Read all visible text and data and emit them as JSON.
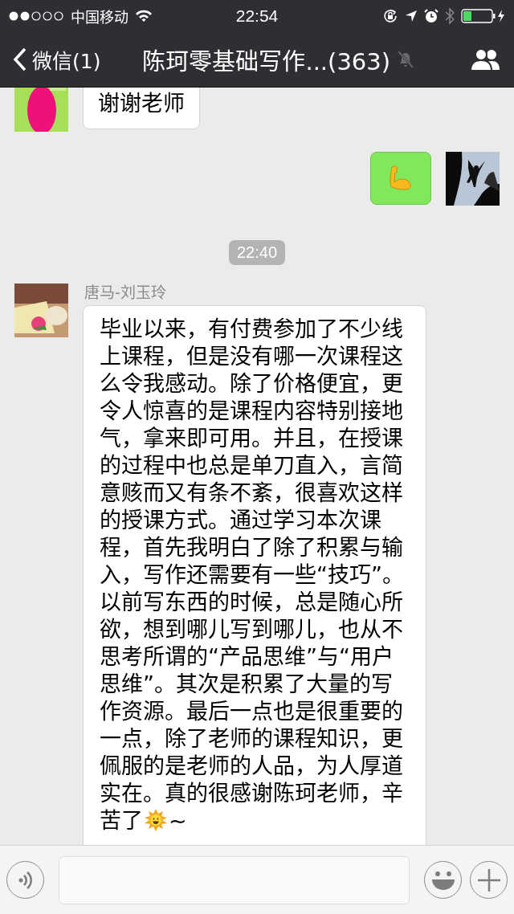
{
  "status_bar": {
    "carrier": "中国移动",
    "time": "22:54"
  },
  "nav": {
    "back_label": "微信(1)",
    "title": "陈珂零基础写作...(363)",
    "muted": true
  },
  "messages": [
    {
      "kind": "text",
      "outgoing": false,
      "text": "谢谢老师"
    },
    {
      "kind": "emoji",
      "outgoing": true
    },
    {
      "kind": "time",
      "text": "22:40"
    },
    {
      "kind": "text",
      "outgoing": false,
      "sender": "唐马-刘玉玲",
      "text": "毕业以来，有付费参加了不少线上课程，但是没有哪一次课程这么令我感动。除了价格便宜，更令人惊喜的是课程内容特别接地气，拿来即可用。并且，在授课的过程中也总是单刀直入，言简意赅而又有条不紊，很喜欢这样的授课方式。通过学习本次课程，首先我明白了除了积累与输入，写作还需要有一些“技巧”。以前写东西的时候，总是随心所欲，想到哪儿写到哪儿，也从不思考所谓的“产品思维”与“用户思维”。其次是积累了大量的写作资源。最后一点也是很重要的一点，除了老师的课程知识，更佩服的是老师的人品，为人厚道实在。真的很感谢陈珂老师，辛苦了",
      "sun": true,
      "suffix": "~"
    }
  ]
}
